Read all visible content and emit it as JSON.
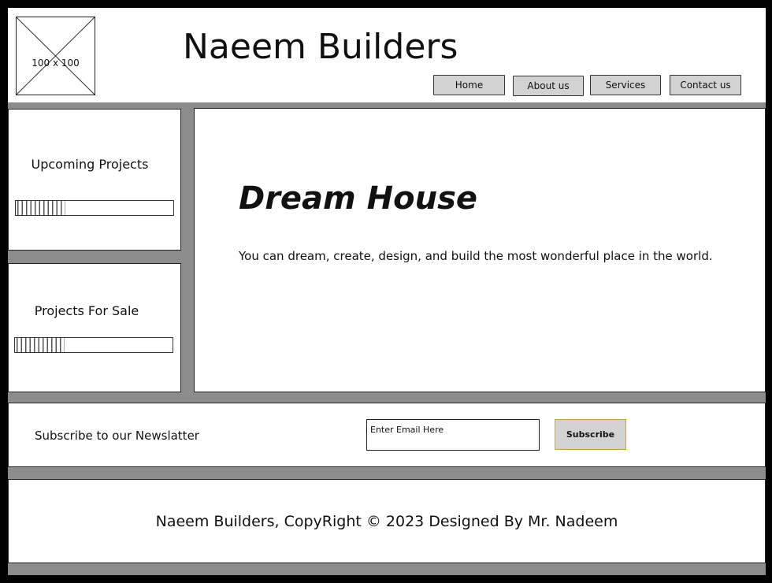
{
  "header": {
    "logo_placeholder": "100 x 100",
    "title": "Naeem Builders",
    "nav": [
      {
        "label": "Home"
      },
      {
        "label": "About us"
      },
      {
        "label": "Services"
      },
      {
        "label": "Contact us"
      }
    ]
  },
  "sidebar": {
    "upcoming": {
      "title": "Upcoming Projects",
      "progress": 0.32
    },
    "for_sale": {
      "title": "Projects For Sale",
      "progress": 0.32
    }
  },
  "main": {
    "heading": "Dream House",
    "text": "You can dream, create, design, and build the most wonderful place in the world."
  },
  "newsletter": {
    "label": "Subscribe to our Newslatter",
    "email_placeholder": "Enter Email Here",
    "subscribe_label": "Subscribe"
  },
  "footer": {
    "copyright": "Naeem Builders, CopyRight © 2023 Designed By Mr. Nadeem"
  },
  "colors": {
    "background": "#8c8c8c",
    "border": "#000000",
    "button": "#d2d2d2",
    "subscribe_border": "#c9a14a"
  }
}
